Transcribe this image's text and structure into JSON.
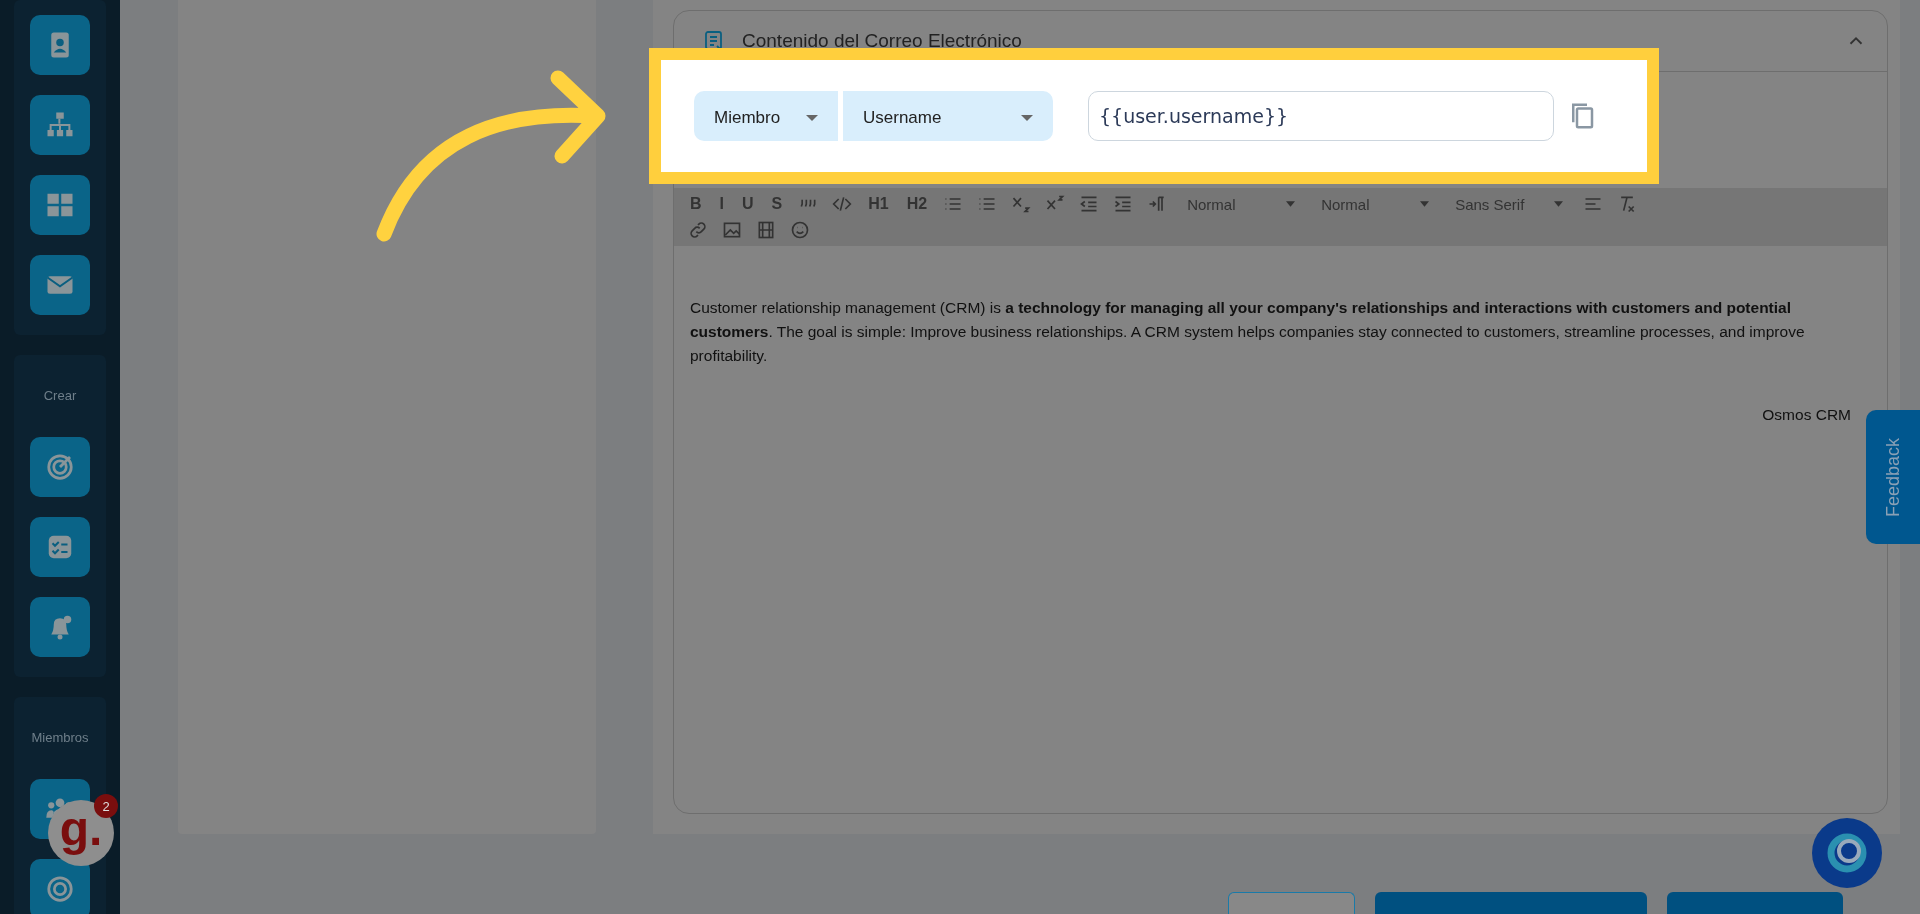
{
  "sidebar": {
    "groups": [
      {
        "items": [
          {
            "kind": "contact"
          },
          {
            "kind": "org"
          },
          {
            "kind": "grid"
          },
          {
            "kind": "mail"
          }
        ]
      },
      {
        "title": "Crear",
        "items": [
          {
            "kind": "target"
          },
          {
            "kind": "checklist"
          },
          {
            "kind": "bell"
          }
        ]
      },
      {
        "title": "Miembros",
        "items": [
          {
            "kind": "people"
          },
          {
            "kind": "ring"
          }
        ]
      }
    ]
  },
  "chat_badge": {
    "logo": "g.",
    "count": "2"
  },
  "email_panel": {
    "title": "Contenido del Correo Electrónico",
    "expanded": true,
    "variable": {
      "entity": "Miembro",
      "field": "Username",
      "token": "{{user.username}}"
    },
    "toolbar": {
      "rows": [
        [
          {
            "kind": "glyph",
            "label": "B"
          },
          {
            "kind": "glyph",
            "label": "I"
          },
          {
            "kind": "glyph",
            "label": "U"
          },
          {
            "kind": "glyph",
            "label": "S"
          },
          {
            "kind": "quote"
          },
          {
            "kind": "code"
          },
          {
            "kind": "glyph",
            "label": "H1"
          },
          {
            "kind": "glyph",
            "label": "H2"
          },
          {
            "kind": "ordered-list"
          },
          {
            "kind": "bullet-list"
          },
          {
            "kind": "subscript"
          },
          {
            "kind": "superscript"
          },
          {
            "kind": "outdent"
          },
          {
            "kind": "indent"
          },
          {
            "kind": "direction"
          },
          {
            "kind": "select",
            "label": "Normal"
          },
          {
            "kind": "select",
            "label": "Normal"
          },
          {
            "kind": "select",
            "label": "Sans Serif"
          },
          {
            "kind": "align"
          },
          {
            "kind": "clear"
          }
        ],
        [
          {
            "kind": "link"
          },
          {
            "kind": "image"
          },
          {
            "kind": "video"
          },
          {
            "kind": "emoji"
          }
        ]
      ]
    },
    "body": "Customer relationship management (CRM) is **a technology for managing all your company's relationships and interactions with customers and potential customers**. The goal is simple: Improve business relationships. A CRM system helps companies stay connected to customers, streamline processes, and improve profitability.",
    "signature": "Osmos CRM"
  },
  "feedback_tab": "Feedback"
}
